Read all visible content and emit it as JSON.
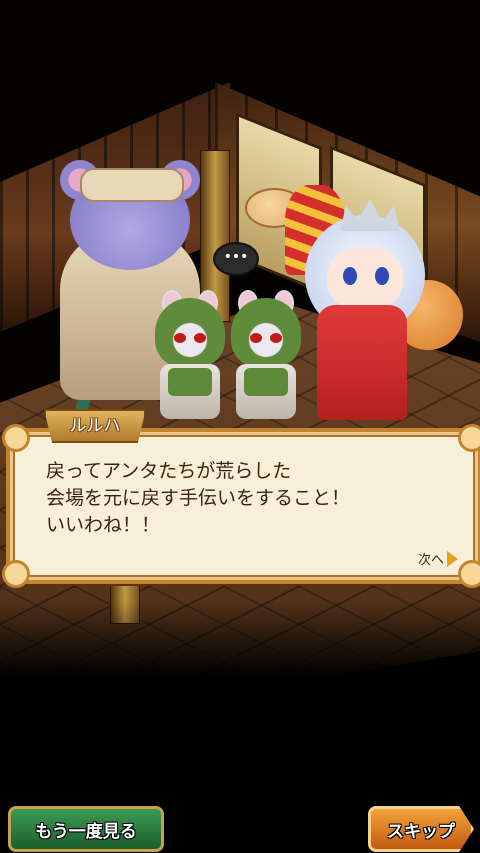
{
  "dialog": {
    "speaker": "ルルハ",
    "text": "戻ってアンタたちが荒らした\n会場を元に戻す手伝いをすること！\nいいわね！！",
    "next_label": "次へ"
  },
  "speech_bubble": "•••",
  "buttons": {
    "replay_label": "もう一度見る",
    "skip_label": "スキップ"
  },
  "colors": {
    "dialog_bg": "#f8efd9",
    "dialog_border": "#c3842f",
    "replay_button": "#2e7d45",
    "skip_button": "#e07a20"
  },
  "icons": {
    "next": "triangle-right-icon"
  }
}
